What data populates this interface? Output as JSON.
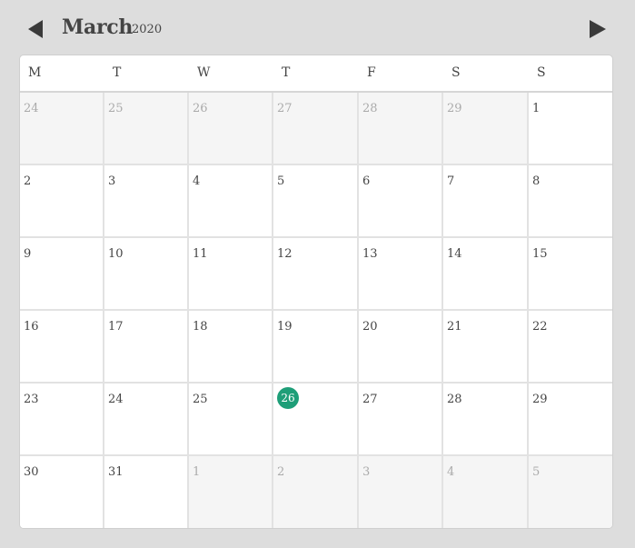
{
  "header": {
    "month": "March",
    "year": "2020",
    "prev_icon": "triangle-left-icon",
    "next_icon": "triangle-right-icon"
  },
  "colors": {
    "background": "#dddddd",
    "text": "#444444",
    "muted_text": "#aaaaaa",
    "other_month_bg": "#f5f5f5",
    "today_highlight": "#1e9e78"
  },
  "weekdays": [
    "M",
    "T",
    "W",
    "T",
    "F",
    "S",
    "S"
  ],
  "today": "26",
  "weeks": [
    [
      {
        "d": "24",
        "other": true
      },
      {
        "d": "25",
        "other": true
      },
      {
        "d": "26",
        "other": true
      },
      {
        "d": "27",
        "other": true
      },
      {
        "d": "28",
        "other": true
      },
      {
        "d": "29",
        "other": true
      },
      {
        "d": "1",
        "other": false
      }
    ],
    [
      {
        "d": "2",
        "other": false
      },
      {
        "d": "3",
        "other": false
      },
      {
        "d": "4",
        "other": false
      },
      {
        "d": "5",
        "other": false
      },
      {
        "d": "6",
        "other": false
      },
      {
        "d": "7",
        "other": false
      },
      {
        "d": "8",
        "other": false
      }
    ],
    [
      {
        "d": "9",
        "other": false
      },
      {
        "d": "10",
        "other": false
      },
      {
        "d": "11",
        "other": false
      },
      {
        "d": "12",
        "other": false
      },
      {
        "d": "13",
        "other": false
      },
      {
        "d": "14",
        "other": false
      },
      {
        "d": "15",
        "other": false
      }
    ],
    [
      {
        "d": "16",
        "other": false
      },
      {
        "d": "17",
        "other": false
      },
      {
        "d": "18",
        "other": false
      },
      {
        "d": "19",
        "other": false
      },
      {
        "d": "20",
        "other": false
      },
      {
        "d": "21",
        "other": false
      },
      {
        "d": "22",
        "other": false
      }
    ],
    [
      {
        "d": "23",
        "other": false
      },
      {
        "d": "24",
        "other": false
      },
      {
        "d": "25",
        "other": false
      },
      {
        "d": "26",
        "other": false,
        "today": true
      },
      {
        "d": "27",
        "other": false
      },
      {
        "d": "28",
        "other": false
      },
      {
        "d": "29",
        "other": false
      }
    ],
    [
      {
        "d": "30",
        "other": false
      },
      {
        "d": "31",
        "other": false
      },
      {
        "d": "1",
        "other": true
      },
      {
        "d": "2",
        "other": true
      },
      {
        "d": "3",
        "other": true
      },
      {
        "d": "4",
        "other": true
      },
      {
        "d": "5",
        "other": true
      }
    ]
  ]
}
